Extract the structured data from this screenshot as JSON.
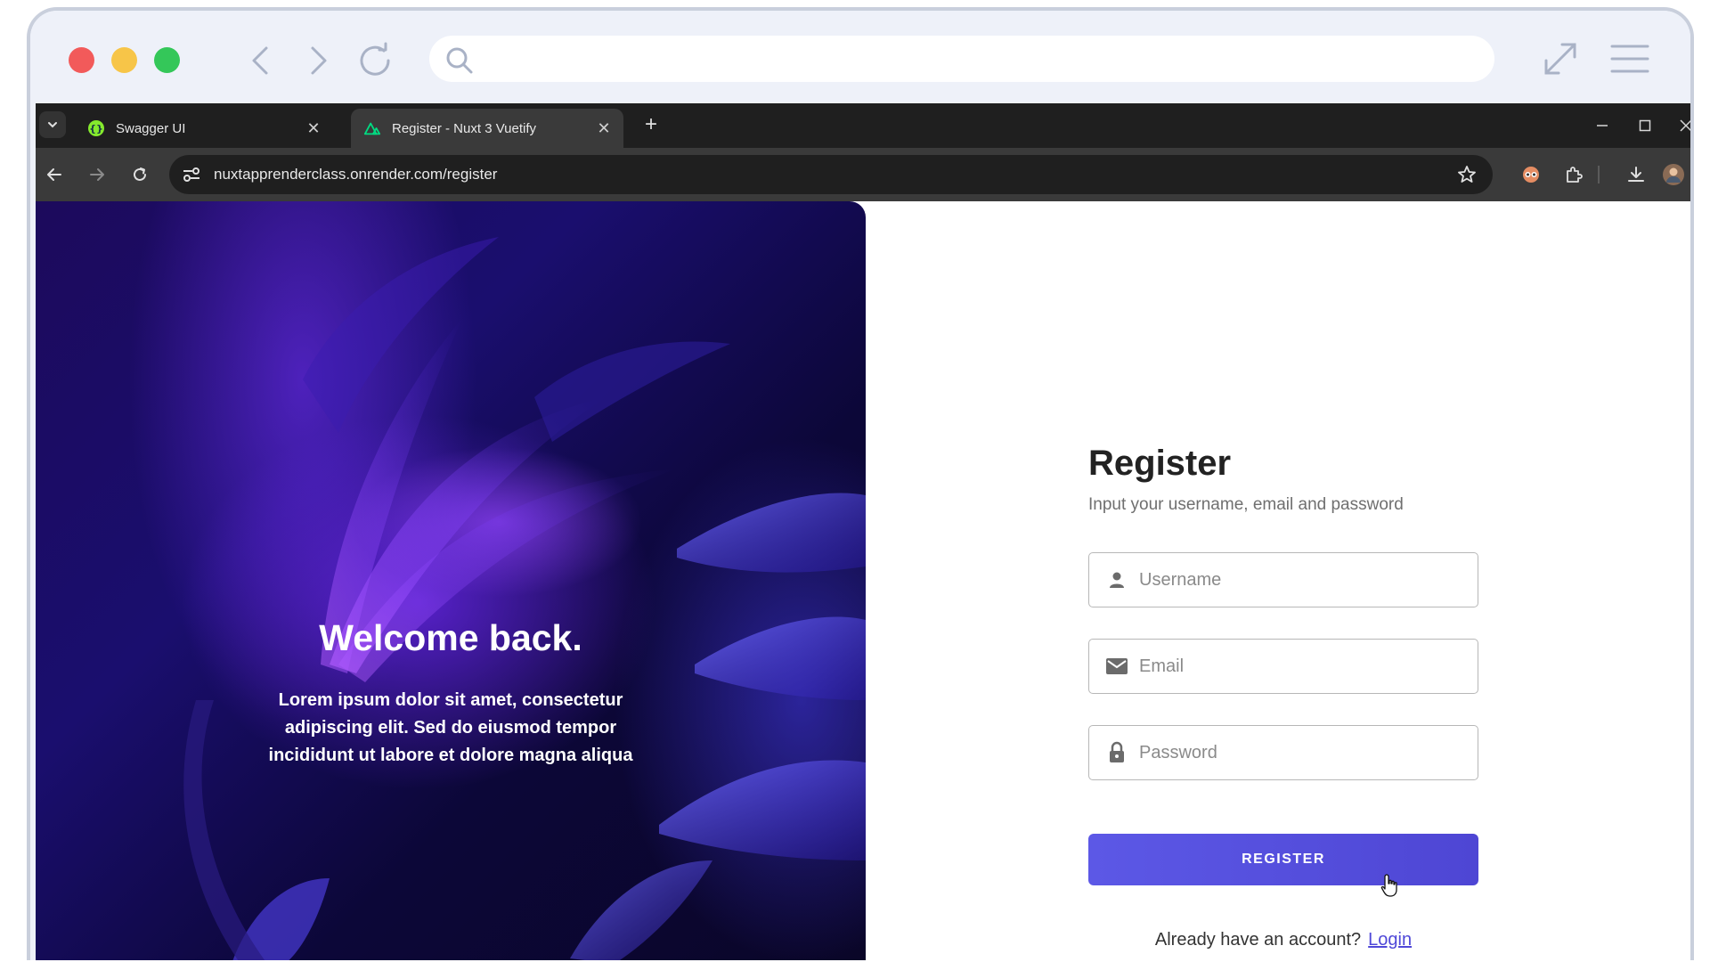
{
  "browser": {
    "tabs": [
      {
        "title": "Swagger UI",
        "active": false,
        "favicon": "swagger-icon"
      },
      {
        "title": "Register - Nuxt 3 Vuetify",
        "active": true,
        "favicon": "nuxt-icon"
      }
    ],
    "url": "nuxtapprenderclass.onrender.com/register"
  },
  "hero": {
    "title": "Welcome back.",
    "text": "Lorem ipsum dolor sit amet, consectetur adipiscing elit. Sed do eiusmod tempor incididunt ut labore et dolore magna aliqua"
  },
  "form": {
    "title": "Register",
    "subtitle": "Input your username, email and password",
    "username_placeholder": "Username",
    "email_placeholder": "Email",
    "password_placeholder": "Password",
    "submit_label": "REGISTER",
    "login_prompt": "Already have an account?",
    "login_link": "Login"
  },
  "colors": {
    "accent": "#5c58e6",
    "link": "#4f48d8",
    "chrome_dark": "#1f1f1f"
  }
}
